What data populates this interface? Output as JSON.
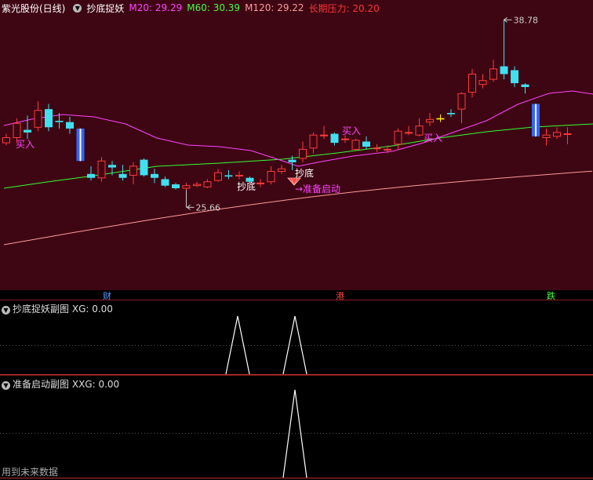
{
  "header": {
    "stock_name": "紫光股份(日线)",
    "indicator": "抄底捉妖",
    "m20": "M20: 29.29",
    "m60": "M60: 30.39",
    "m120": "M120: 29.22",
    "long_pressure": "长期压力: 20.20",
    "colors": {
      "m20": "#ff44ff",
      "m60": "#44ff44",
      "m120": "#ff9999",
      "pressure": "#ff3333"
    }
  },
  "chart": {
    "high_label": "38.78",
    "low_label": "25.66",
    "annotations": [
      "买入",
      "买入",
      "买入",
      "抄底",
      "抄底",
      "→准备启动"
    ]
  },
  "bottom_labels": [
    {
      "text": "财",
      "color": "#5599ff"
    },
    {
      "text": "港",
      "color": "#ff4444"
    },
    {
      "text": "跌",
      "color": "#44ff44"
    }
  ],
  "sub1": {
    "title": "抄底捉妖副图",
    "value": "XG: 0.00"
  },
  "sub2": {
    "title": "准备启动副图",
    "value": "XXG: 0.00"
  },
  "footer": "用到未来数据",
  "chart_data": {
    "type": "candlestick",
    "candles": [
      {
        "o": 29.3,
        "c": 29.7,
        "h": 30.0,
        "l": 29.1
      },
      {
        "o": 29.7,
        "c": 30.8,
        "h": 31.2,
        "l": 29.3
      },
      {
        "o": 30.3,
        "c": 30.1,
        "h": 31.4,
        "l": 29.6
      },
      {
        "o": 30.5,
        "c": 31.8,
        "h": 32.5,
        "l": 30.2
      },
      {
        "o": 31.9,
        "c": 30.5,
        "h": 32.3,
        "l": 30.2
      },
      {
        "o": 31.0,
        "c": 30.9,
        "h": 31.6,
        "l": 30.4
      },
      {
        "o": 30.9,
        "c": 30.4,
        "h": 31.3,
        "l": 30.0
      },
      {
        "o": 30.3,
        "c": 28.0,
        "h": 30.4,
        "l": 27.9
      },
      {
        "o": 26.9,
        "c": 26.6,
        "h": 27.5,
        "l": 26.4
      },
      {
        "o": 26.6,
        "c": 27.9,
        "h": 28.2,
        "l": 26.3
      },
      {
        "o": 27.6,
        "c": 27.4,
        "h": 27.9,
        "l": 26.8
      },
      {
        "o": 26.9,
        "c": 26.6,
        "h": 27.6,
        "l": 26.4
      },
      {
        "o": 26.8,
        "c": 27.5,
        "h": 27.8,
        "l": 26.1
      },
      {
        "o": 28.0,
        "c": 26.8,
        "h": 28.1,
        "l": 26.7
      },
      {
        "o": 26.9,
        "c": 26.6,
        "h": 27.3,
        "l": 26.2
      },
      {
        "o": 26.5,
        "c": 26.0,
        "h": 26.7,
        "l": 25.9
      },
      {
        "o": 26.1,
        "c": 25.8,
        "h": 26.2,
        "l": 25.7
      },
      {
        "o": 25.8,
        "c": 26.0,
        "h": 26.2,
        "l": 25.66
      },
      {
        "o": 26.0,
        "c": 26.1,
        "h": 26.3,
        "l": 25.9
      },
      {
        "o": 25.9,
        "c": 26.3,
        "h": 26.5,
        "l": 25.8
      },
      {
        "o": 26.4,
        "c": 27.0,
        "h": 27.3,
        "l": 26.3
      },
      {
        "o": 26.8,
        "c": 26.7,
        "h": 27.2,
        "l": 26.5
      },
      {
        "o": 26.8,
        "c": 26.8,
        "h": 27.1,
        "l": 26.5
      },
      {
        "o": 26.6,
        "c": 26.3,
        "h": 26.7,
        "l": 26.2
      },
      {
        "o": 26.2,
        "c": 26.2,
        "h": 26.5,
        "l": 25.9
      },
      {
        "o": 26.3,
        "c": 27.1,
        "h": 27.5,
        "l": 26.1
      },
      {
        "o": 27.1,
        "c": 27.3,
        "h": 27.6,
        "l": 26.9
      },
      {
        "o": 28.0,
        "c": 27.8,
        "h": 28.3,
        "l": 27.2
      },
      {
        "o": 28.1,
        "c": 28.8,
        "h": 29.4,
        "l": 27.8
      },
      {
        "o": 28.9,
        "c": 29.9,
        "h": 30.1,
        "l": 28.5
      },
      {
        "o": 29.9,
        "c": 29.9,
        "h": 30.6,
        "l": 29.6
      },
      {
        "o": 30.0,
        "c": 29.3,
        "h": 30.1,
        "l": 29.1
      },
      {
        "o": 29.6,
        "c": 29.6,
        "h": 29.9,
        "l": 29.3
      },
      {
        "o": 28.8,
        "c": 29.5,
        "h": 29.6,
        "l": 28.7
      },
      {
        "o": 29.4,
        "c": 29.0,
        "h": 29.8,
        "l": 28.8
      },
      {
        "o": 28.9,
        "c": 28.9,
        "h": 29.2,
        "l": 28.6
      },
      {
        "o": 28.8,
        "c": 28.8,
        "h": 29.1,
        "l": 28.5
      },
      {
        "o": 29.2,
        "c": 30.2,
        "h": 30.4,
        "l": 28.8
      },
      {
        "o": 30.1,
        "c": 30.1,
        "h": 30.6,
        "l": 29.9
      },
      {
        "o": 29.9,
        "c": 30.6,
        "h": 31.2,
        "l": 29.8
      },
      {
        "o": 30.9,
        "c": 31.1,
        "h": 31.6,
        "l": 30.6
      },
      {
        "o": 31.2,
        "c": 31.1,
        "h": 31.5,
        "l": 30.9
      },
      {
        "o": 31.6,
        "c": 31.5,
        "h": 31.9,
        "l": 31.3
      },
      {
        "o": 31.9,
        "c": 33.1,
        "h": 33.2,
        "l": 30.8
      },
      {
        "o": 33.2,
        "c": 34.6,
        "h": 35.0,
        "l": 32.8
      },
      {
        "o": 33.8,
        "c": 34.1,
        "h": 34.6,
        "l": 33.5
      },
      {
        "o": 34.2,
        "c": 35.0,
        "h": 35.7,
        "l": 34.0
      },
      {
        "o": 35.2,
        "c": 34.6,
        "h": 38.78,
        "l": 34.2
      },
      {
        "o": 34.9,
        "c": 33.9,
        "h": 35.2,
        "l": 33.6
      },
      {
        "o": 33.8,
        "c": 33.6,
        "h": 33.9,
        "l": 33.1
      },
      {
        "o": 32.1,
        "c": 30.2,
        "h": 32.3,
        "l": 29.8
      },
      {
        "o": 29.7,
        "c": 29.9,
        "h": 30.4,
        "l": 29.1
      },
      {
        "o": 29.8,
        "c": 30.1,
        "h": 30.5,
        "l": 29.6
      },
      {
        "o": 30.0,
        "c": 30.0,
        "h": 30.5,
        "l": 29.2
      }
    ]
  }
}
